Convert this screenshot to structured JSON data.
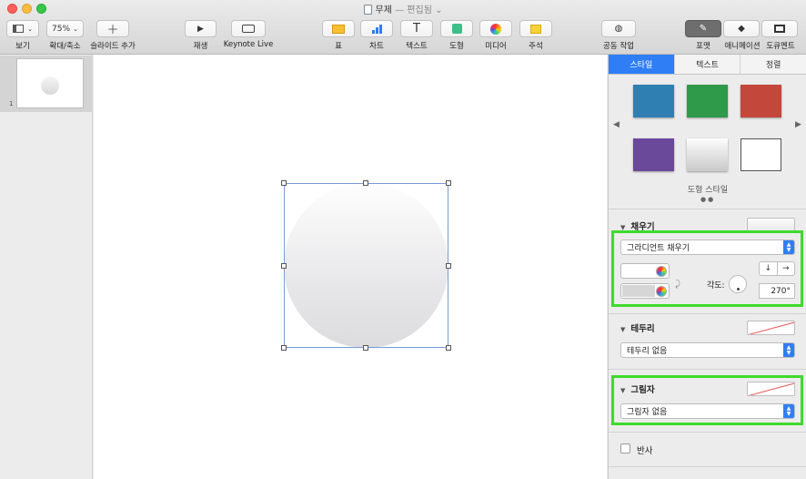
{
  "window": {
    "title": "무제",
    "separator": "—",
    "status": "편집됨"
  },
  "toolbar": {
    "view_label": "보기",
    "zoom_value": "75%",
    "zoom_label": "확대/축소",
    "add_slide_label": "슬라이드 추가",
    "play_label": "재생",
    "keynote_live_label": "Keynote Live",
    "table_label": "표",
    "chart_label": "차트",
    "text_label": "텍스트",
    "shape_label": "도형",
    "media_label": "미디어",
    "comment_label": "주석",
    "collaborate_label": "공동 작업",
    "format_label": "포맷",
    "animate_label": "애니메이션",
    "document_label": "도큐멘트"
  },
  "navigator": {
    "slides": [
      {
        "number": "1"
      }
    ]
  },
  "inspector": {
    "tabs": [
      {
        "label": "스타일",
        "active": true
      },
      {
        "label": "텍스트",
        "active": false
      },
      {
        "label": "정렬",
        "active": false
      }
    ],
    "shape_styles": {
      "caption": "도형 스타일",
      "swatches": [
        "#2f7fb3",
        "#2e9a4a",
        "#c3473a",
        "#6a489a",
        "gradient-grey",
        "outline-white"
      ]
    },
    "fill": {
      "title": "채우기",
      "type": "그라디언트 채우기",
      "color_start": "#ffffff",
      "color_end": "#d6d6d6",
      "angle_label": "각도:",
      "angle_value": "270°"
    },
    "border": {
      "title": "테두리",
      "type": "테두리 없음"
    },
    "shadow": {
      "title": "그림자",
      "type": "그림자 없음"
    },
    "reflection": {
      "label": "반사",
      "checked": false
    }
  },
  "colors": {
    "accent": "#2f7ef5",
    "highlight_frame": "#3edb2b",
    "selection": "#7b9bd8"
  }
}
